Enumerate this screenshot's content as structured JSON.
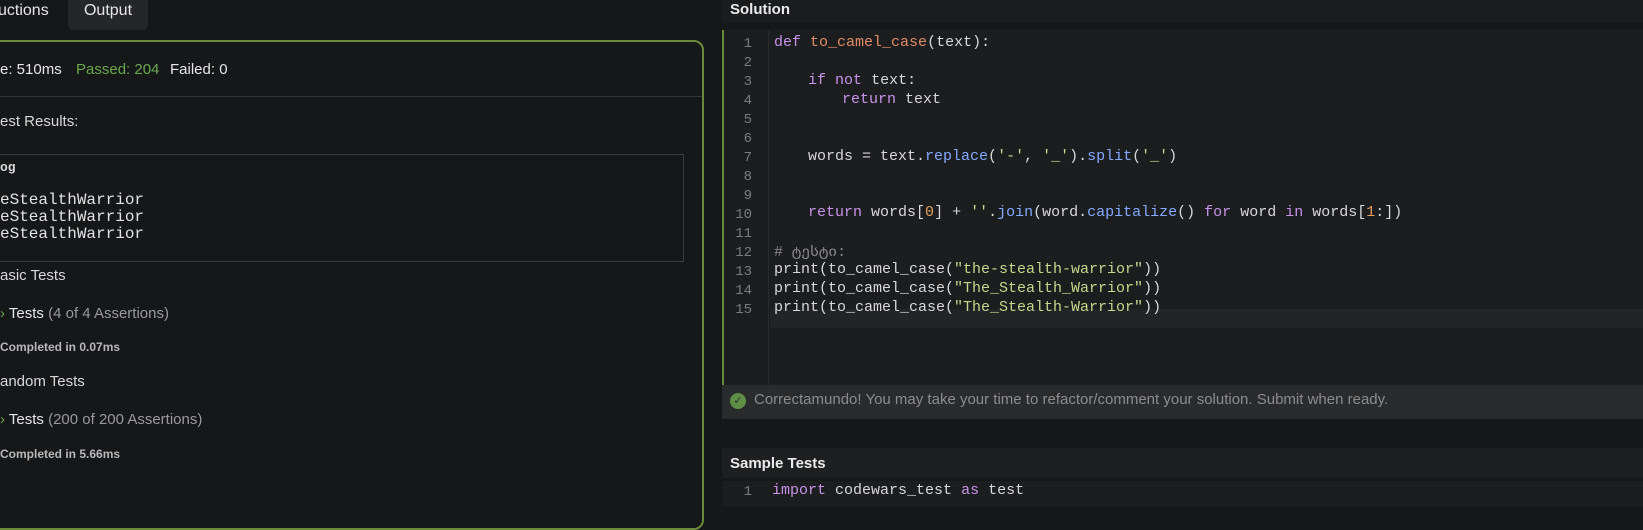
{
  "tabs": {
    "instructions": "uctions",
    "output": "Output"
  },
  "stats": {
    "time": "e: 510ms",
    "passed": "Passed: 204",
    "failed": "Failed: 0"
  },
  "results": {
    "heading": "est Results:",
    "log": {
      "title": "og",
      "lines": [
        "eStealthWarrior",
        "eStealthWarrior",
        "eStealthWarrior"
      ]
    },
    "basic": {
      "title": "asic Tests",
      "tests_label": "Tests",
      "assertions": "(4 of 4 Assertions)",
      "completed": "Completed in 0.07ms"
    },
    "random": {
      "title": "andom Tests",
      "tests_label": "Tests",
      "assertions": "(200 of 200 Assertions)",
      "completed": "Completed in 5.66ms"
    }
  },
  "solution": {
    "title": "Solution",
    "line_numbers": [
      "1",
      "2",
      "3",
      "4",
      "5",
      "6",
      "7",
      "8",
      "9",
      "10",
      "11",
      "12",
      "13",
      "14",
      "15"
    ],
    "code": {
      "l1": {
        "kw": "def",
        "name": "to_camel_case",
        "rest": "(text):"
      },
      "l3": {
        "kw1": "if",
        "kw2": "not",
        "rest": "text:"
      },
      "l4": {
        "kw": "return",
        "rest": "text"
      },
      "l7": {
        "a": "words = text.",
        "m1": "replace",
        "b": "(",
        "s1": "'-'",
        "c": ", ",
        "s2": "'_'",
        "d": ").",
        "m2": "split",
        "e": "(",
        "s3": "'_'",
        "f": ")"
      },
      "l10": {
        "kw": "return",
        "a": "words[",
        "n0": "0",
        "b": "] + ",
        "s1": "''",
        "c": ".",
        "m1": "join",
        "d": "(word.",
        "m2": "capitalize",
        "e": "() ",
        "kw2": "for",
        "f": "word",
        "kw3": "in",
        "g": "words[",
        "n1": "1",
        "h": ":])"
      },
      "l12": "# ტესტი:",
      "l13": {
        "a": "print(to_camel_case(",
        "s": "\"the-stealth-warrior\"",
        "b": "))"
      },
      "l14": {
        "a": "print(to_camel_case(",
        "s": "\"The_Stealth_Warrior\"",
        "b": "))"
      },
      "l15": {
        "a": "print(to_camel_case(",
        "s": "\"The_Stealth-Warrior\"",
        "b": "))"
      }
    },
    "banner": "Correctamundo! You may take your time to refactor/comment your solution. Submit when ready."
  },
  "sample": {
    "title": "Sample Tests",
    "line1_num": "1",
    "line1": {
      "kw1": "import",
      "a": "codewars_test",
      "kw2": "as",
      "b": "test"
    }
  },
  "colors": {
    "accent": "#6a8a3a",
    "passed": "#6aa84f",
    "keyword": "#c792ea",
    "function": "#e08c64",
    "method": "#82aaff",
    "string": "#c3d88a",
    "number": "#e6a15a"
  },
  "icons": {
    "chevron": "chevron-right-icon",
    "check": "check-circle-icon"
  }
}
